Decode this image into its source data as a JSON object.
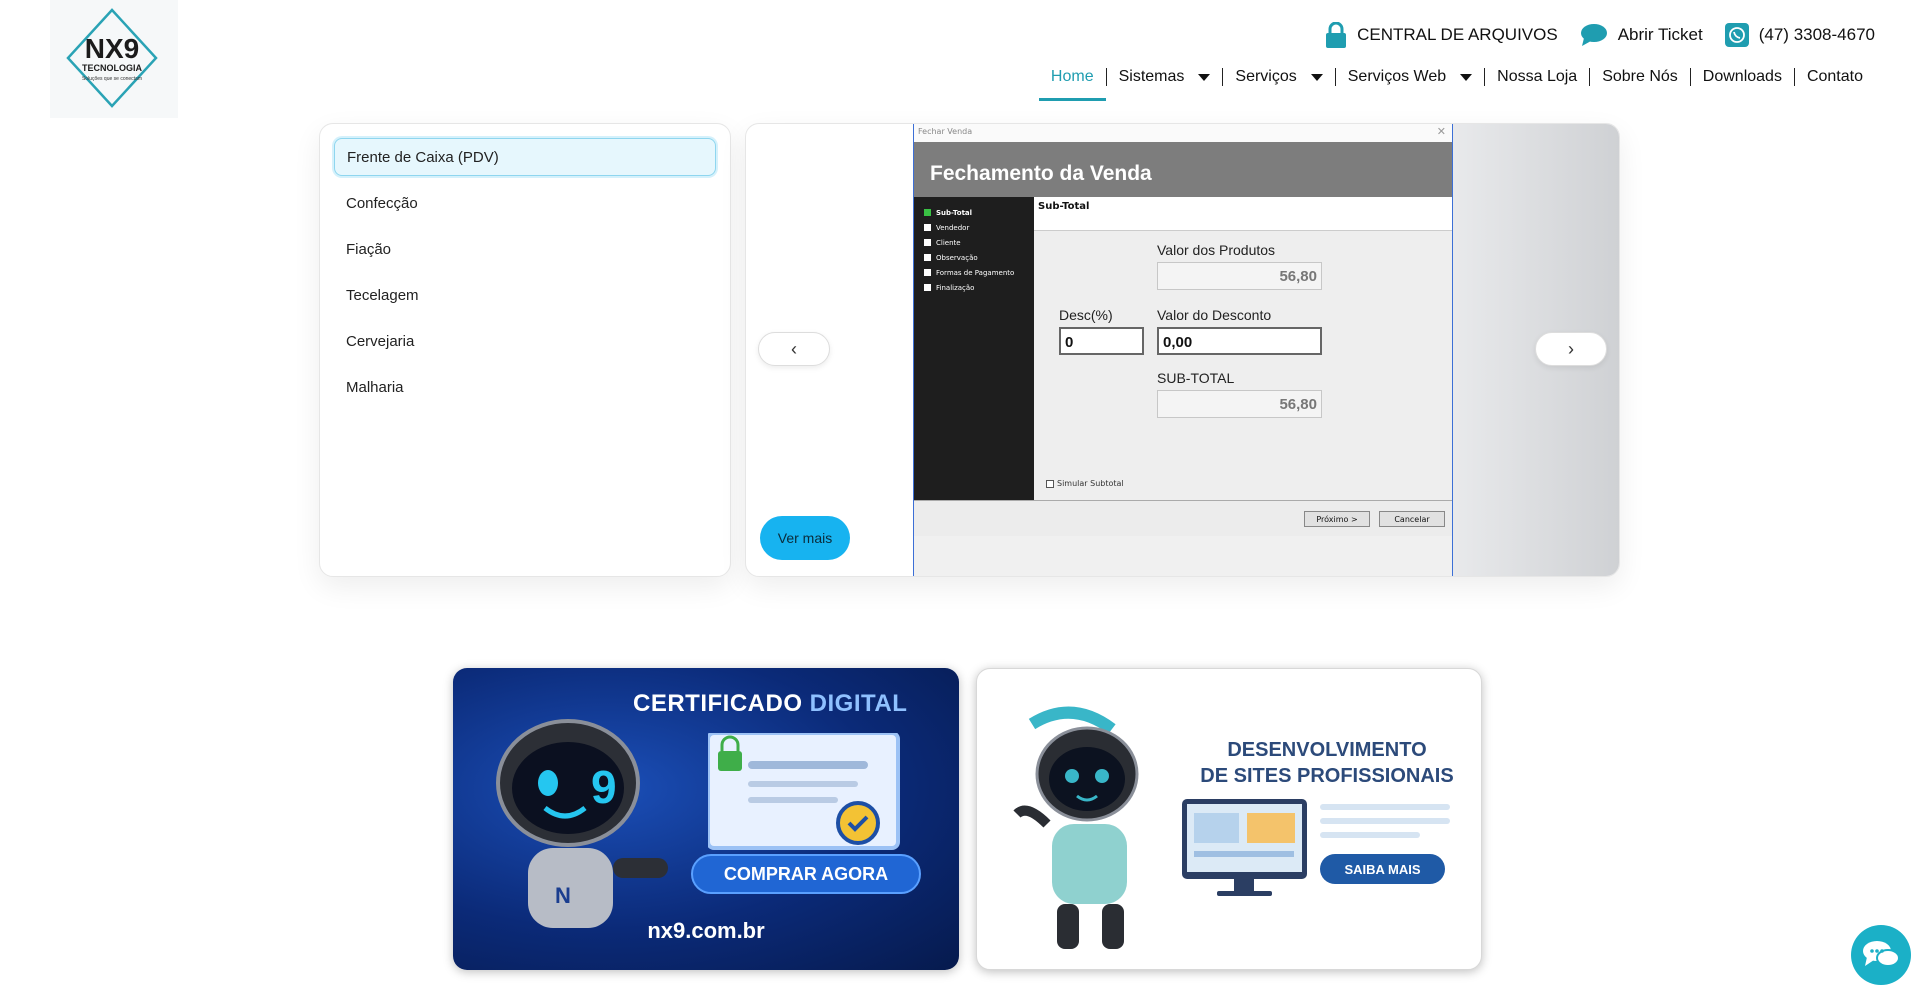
{
  "header": {
    "logo_text": "NX9",
    "logo_sub": "TECNOLOGIA",
    "logo_tagline": "Soluções que se conectam",
    "top": {
      "files": "CENTRAL DE ARQUIVOS",
      "ticket": "Abrir Ticket",
      "phone": "(47) 3308-4670"
    },
    "nav": [
      "Home",
      "Sistemas",
      "Serviços",
      "Serviços Web",
      "Nossa Loja",
      "Sobre Nós",
      "Downloads",
      "Contato"
    ]
  },
  "systems_list": {
    "items": [
      "Frente de Caixa (PDV)",
      "Confecção",
      "Fiação",
      "Tecelagem",
      "Cervejaria",
      "Malharia"
    ],
    "selected": "Frente de Caixa (PDV)"
  },
  "carousel": {
    "prev": "‹",
    "next": "›",
    "cta": "Ver mais",
    "screen": {
      "window_title": "Fechar Venda",
      "heading": "Fechamento da Venda",
      "steps": [
        "Sub-Total",
        "Vendedor",
        "Cliente",
        "Observação",
        "Formas de Pagamento",
        "Finalização"
      ],
      "section": "Sub-Total",
      "valor_produtos_label": "Valor dos Produtos",
      "valor_produtos": "56,80",
      "desc_label": "Desc(%)",
      "desc_value": "0",
      "valor_desconto_label": "Valor do Desconto",
      "valor_desconto": "0,00",
      "subtotal_label": "SUB-TOTAL",
      "subtotal": "56,80",
      "simular": "Simular Subtotal",
      "btn_next": "Próximo >",
      "btn_cancel": "Cancelar"
    }
  },
  "banners": {
    "certificado": {
      "title_a": "CERTIFICADO ",
      "title_b": "DIGITAL",
      "cta": "COMPRAR AGORA",
      "url": "nx9.com.br"
    },
    "sites": {
      "title_1": "DESENVOLVIMENTO",
      "title_2": "DE SITES PROFISSIONAIS",
      "cta": "SAIBA MAIS"
    }
  },
  "colors": {
    "accent": "#1f9db0",
    "cta": "#17b3f0",
    "whatsapp": "#1f9db0"
  }
}
